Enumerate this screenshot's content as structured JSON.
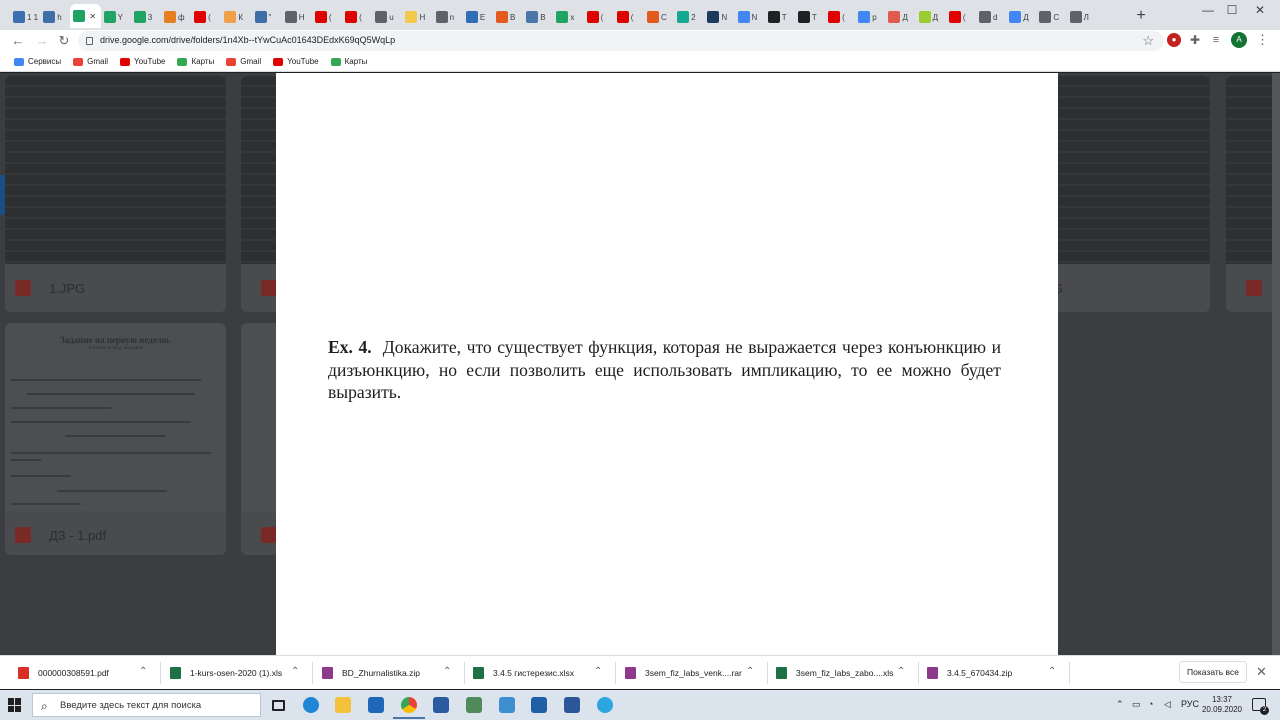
{
  "browser": {
    "tabs": [
      {
        "text": "1 1",
        "color": "#3a6fb0"
      },
      {
        "text": "h",
        "color": "#3d6ea8"
      },
      {
        "text": "",
        "color": "#1fa463",
        "active": true
      },
      {
        "text": "Y",
        "color": "#1fa463"
      },
      {
        "text": "3",
        "color": "#1fa463"
      },
      {
        "text": "ф",
        "color": "#e67e22"
      },
      {
        "text": "(",
        "color": "#e00000"
      },
      {
        "text": "К",
        "color": "#f0a04b"
      },
      {
        "text": "\"",
        "color": "#3d6ea8"
      },
      {
        "text": "Н",
        "color": "#5f6368"
      },
      {
        "text": "(",
        "color": "#e00000"
      },
      {
        "text": "(",
        "color": "#e00000"
      },
      {
        "text": "u",
        "color": "#5f6368"
      },
      {
        "text": "Н",
        "color": "#f2c94c"
      },
      {
        "text": "n",
        "color": "#5f6368"
      },
      {
        "text": "E",
        "color": "#2f6db5"
      },
      {
        "text": "В",
        "color": "#e25a1c"
      },
      {
        "text": "В",
        "color": "#4a76a8"
      },
      {
        "text": "x",
        "color": "#1fa463"
      },
      {
        "text": "(",
        "color": "#e00000"
      },
      {
        "text": "(",
        "color": "#e00000"
      },
      {
        "text": "С",
        "color": "#e25a1c"
      },
      {
        "text": "2",
        "color": "#12a892"
      },
      {
        "text": "N",
        "color": "#1b3a5c"
      },
      {
        "text": "N",
        "color": "#4285f4"
      },
      {
        "text": "T",
        "color": "#202124"
      },
      {
        "text": "T",
        "color": "#202124"
      },
      {
        "text": "(",
        "color": "#e00000"
      },
      {
        "text": "p",
        "color": "#4285f4"
      },
      {
        "text": "Д",
        "color": "#e05a4f"
      },
      {
        "text": "Д",
        "color": "#9acd32"
      },
      {
        "text": "(",
        "color": "#e00000"
      },
      {
        "text": "d",
        "color": "#5f6368"
      },
      {
        "text": "Д",
        "color": "#4285f4"
      },
      {
        "text": "С",
        "color": "#5f6368"
      },
      {
        "text": "Л",
        "color": "#5f6368"
      }
    ],
    "url": "drive.google.com/drive/folders/1n4Xb--tYwCuAc01643DEdxK69qQ5WqLp",
    "profile_initial": "A",
    "bookmarks": [
      {
        "label": "Сервисы",
        "icon": "apps-grid-icon",
        "color": "#4285f4"
      },
      {
        "label": "Gmail",
        "icon": "gmail-icon",
        "color": "#ea4335"
      },
      {
        "label": "YouTube",
        "icon": "youtube-icon",
        "color": "#e00000"
      },
      {
        "label": "Карты",
        "icon": "maps-icon",
        "color": "#34a853"
      },
      {
        "label": "Gmail",
        "icon": "gmail-icon",
        "color": "#ea4335"
      },
      {
        "label": "YouTube",
        "icon": "youtube-icon",
        "color": "#e00000"
      },
      {
        "label": "Карты",
        "icon": "maps-icon",
        "color": "#34a853"
      }
    ]
  },
  "drive": {
    "file1_name": "1.JPG",
    "file2_name": "ДЗ - 1.pdf",
    "file3_name_fragment": "G",
    "doc_title": "Задание на первую неделю.",
    "doc_subtitle": "Алгебра логики: введение"
  },
  "viewer": {
    "exercise_label": "Ex. 4.",
    "exercise_text": "Докажите, что существует функция, которая не выражается через конъюнкцию и дизъюнкцию, но если позволить еще использовать импликацию, то ее можно будет выразить."
  },
  "downloads": {
    "items": [
      {
        "name": "000000308591.pdf",
        "color": "#d93025"
      },
      {
        "name": "1-kurs-osen-2020 (1).xls",
        "color": "#1e7145"
      },
      {
        "name": "BD_Zhurnalistika.zip",
        "color": "#8e3a8c"
      },
      {
        "name": "3.4.5 гистерезис.xlsx",
        "color": "#1e7145"
      },
      {
        "name": "3sem_fiz_labs_venk....rar",
        "color": "#8e3a8c"
      },
      {
        "name": "3sem_fiz_labs_zabo....xls",
        "color": "#1e7145"
      },
      {
        "name": "3.4.5_670434.zip",
        "color": "#8e3a8c"
      }
    ],
    "show_all": "Показать все"
  },
  "taskbar": {
    "search_placeholder": "Введите здесь текст для поиска",
    "lang": "РУС",
    "time": "13:37",
    "date": "20.09.2020",
    "notification_count": "2"
  }
}
